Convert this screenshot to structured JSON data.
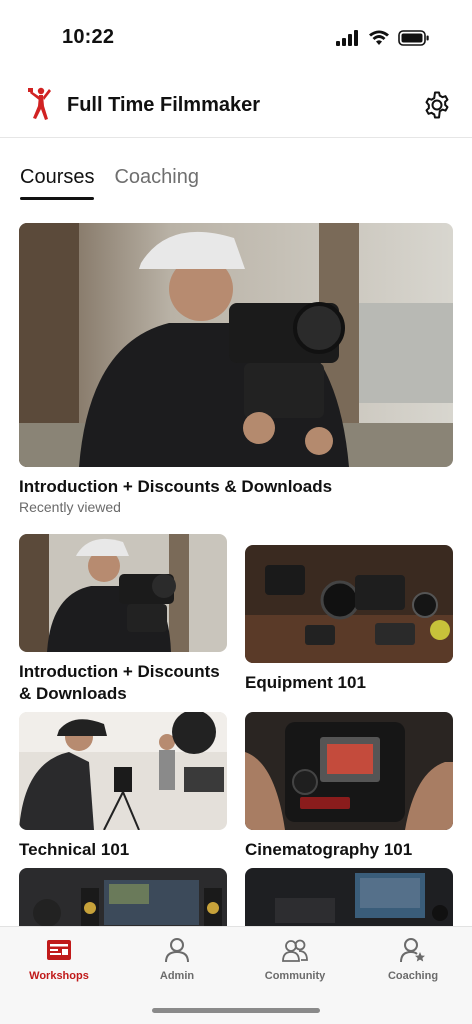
{
  "status_bar": {
    "time": "10:22"
  },
  "header": {
    "title": "Full Time Filmmaker",
    "logo_icon": "filmmaker-logo-icon",
    "settings_icon": "gear-icon"
  },
  "tabs": [
    {
      "label": "Courses",
      "active": true
    },
    {
      "label": "Coaching",
      "active": false
    }
  ],
  "hero": {
    "title": "Introduction + Discounts & Downloads",
    "subtitle": "Recently viewed"
  },
  "courses": [
    {
      "title": "Introduction + Discounts & Downloads"
    },
    {
      "title": "Equipment 101"
    },
    {
      "title": "Technical 101"
    },
    {
      "title": "Cinematography 101"
    }
  ],
  "bottom_nav": [
    {
      "label": "Workshops",
      "icon": "workshops-icon",
      "active": true
    },
    {
      "label": "Admin",
      "icon": "person-icon",
      "active": false
    },
    {
      "label": "Community",
      "icon": "group-icon",
      "active": false
    },
    {
      "label": "Coaching",
      "icon": "person-star-icon",
      "active": false
    }
  ],
  "colors": {
    "accent": "#c01a1a",
    "text": "#111111",
    "muted": "#6f6f6f"
  }
}
